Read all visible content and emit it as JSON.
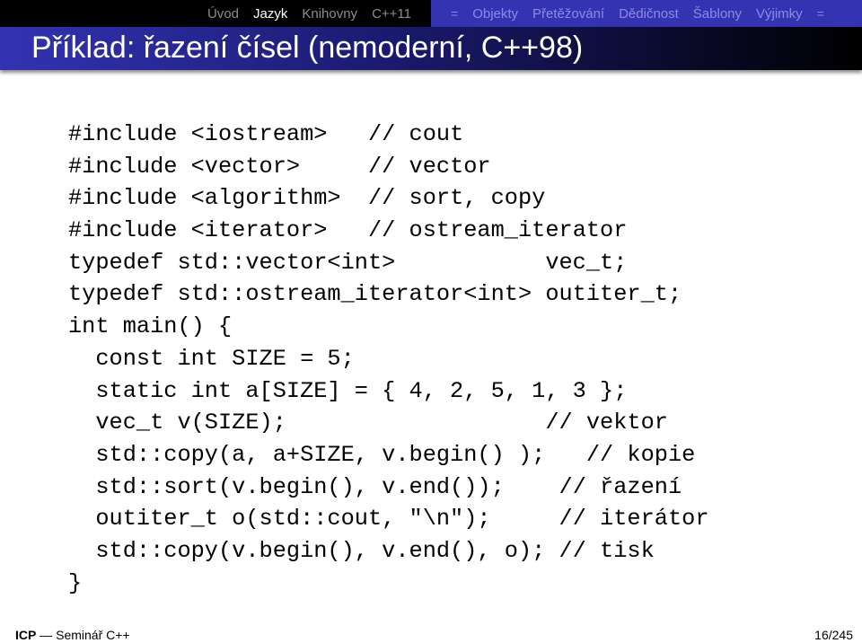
{
  "nav": {
    "sections_left": [
      {
        "label": "Úvod",
        "active": false
      },
      {
        "label": "Jazyk",
        "active": true
      },
      {
        "label": "Knihovny",
        "active": false
      },
      {
        "label": "C++11",
        "active": false
      }
    ],
    "eq_symbol": "=",
    "subsections": [
      {
        "label": "Objekty"
      },
      {
        "label": "Přetěžování"
      },
      {
        "label": "Dědičnost"
      },
      {
        "label": "Šablony"
      },
      {
        "label": "Výjimky"
      }
    ]
  },
  "slide": {
    "title": "Příklad: řazení čísel (nemoderní, C++98)"
  },
  "code": {
    "lines": [
      {
        "code": "#include <iostream>   ",
        "comment": "// cout"
      },
      {
        "code": "#include <vector>     ",
        "comment": "// vector"
      },
      {
        "code": "#include <algorithm>  ",
        "comment": "// sort, copy"
      },
      {
        "code": "#include <iterator>   ",
        "comment": "// ostream_iterator"
      },
      {
        "code": "typedef std::vector<int>           vec_t;",
        "comment": ""
      },
      {
        "code": "typedef std::ostream_iterator<int> outiter_t;",
        "comment": ""
      },
      {
        "code": "int main() {",
        "comment": ""
      },
      {
        "code": "  const int SIZE = 5;",
        "comment": ""
      },
      {
        "code": "  static int a[SIZE] = { 4, 2, 5, 1, 3 };",
        "comment": ""
      },
      {
        "code": "  vec_t v(SIZE);                   ",
        "comment": "// vektor"
      },
      {
        "code": "  std::copy(a, a+SIZE, v.begin() );   ",
        "comment": "// kopie"
      },
      {
        "code": "  std::sort(v.begin(), v.end());    ",
        "comment": "// řazení"
      },
      {
        "code": "  outiter_t o(std::cout, \"\\n\");     ",
        "comment": "// iterátor"
      },
      {
        "code": "  std::copy(v.begin(), v.end(), o); ",
        "comment": "// tisk"
      },
      {
        "code": "}",
        "comment": ""
      }
    ]
  },
  "footer": {
    "brand": "ICP",
    "separator": "—",
    "subtitle": "Seminář C++",
    "page": "16/245"
  }
}
